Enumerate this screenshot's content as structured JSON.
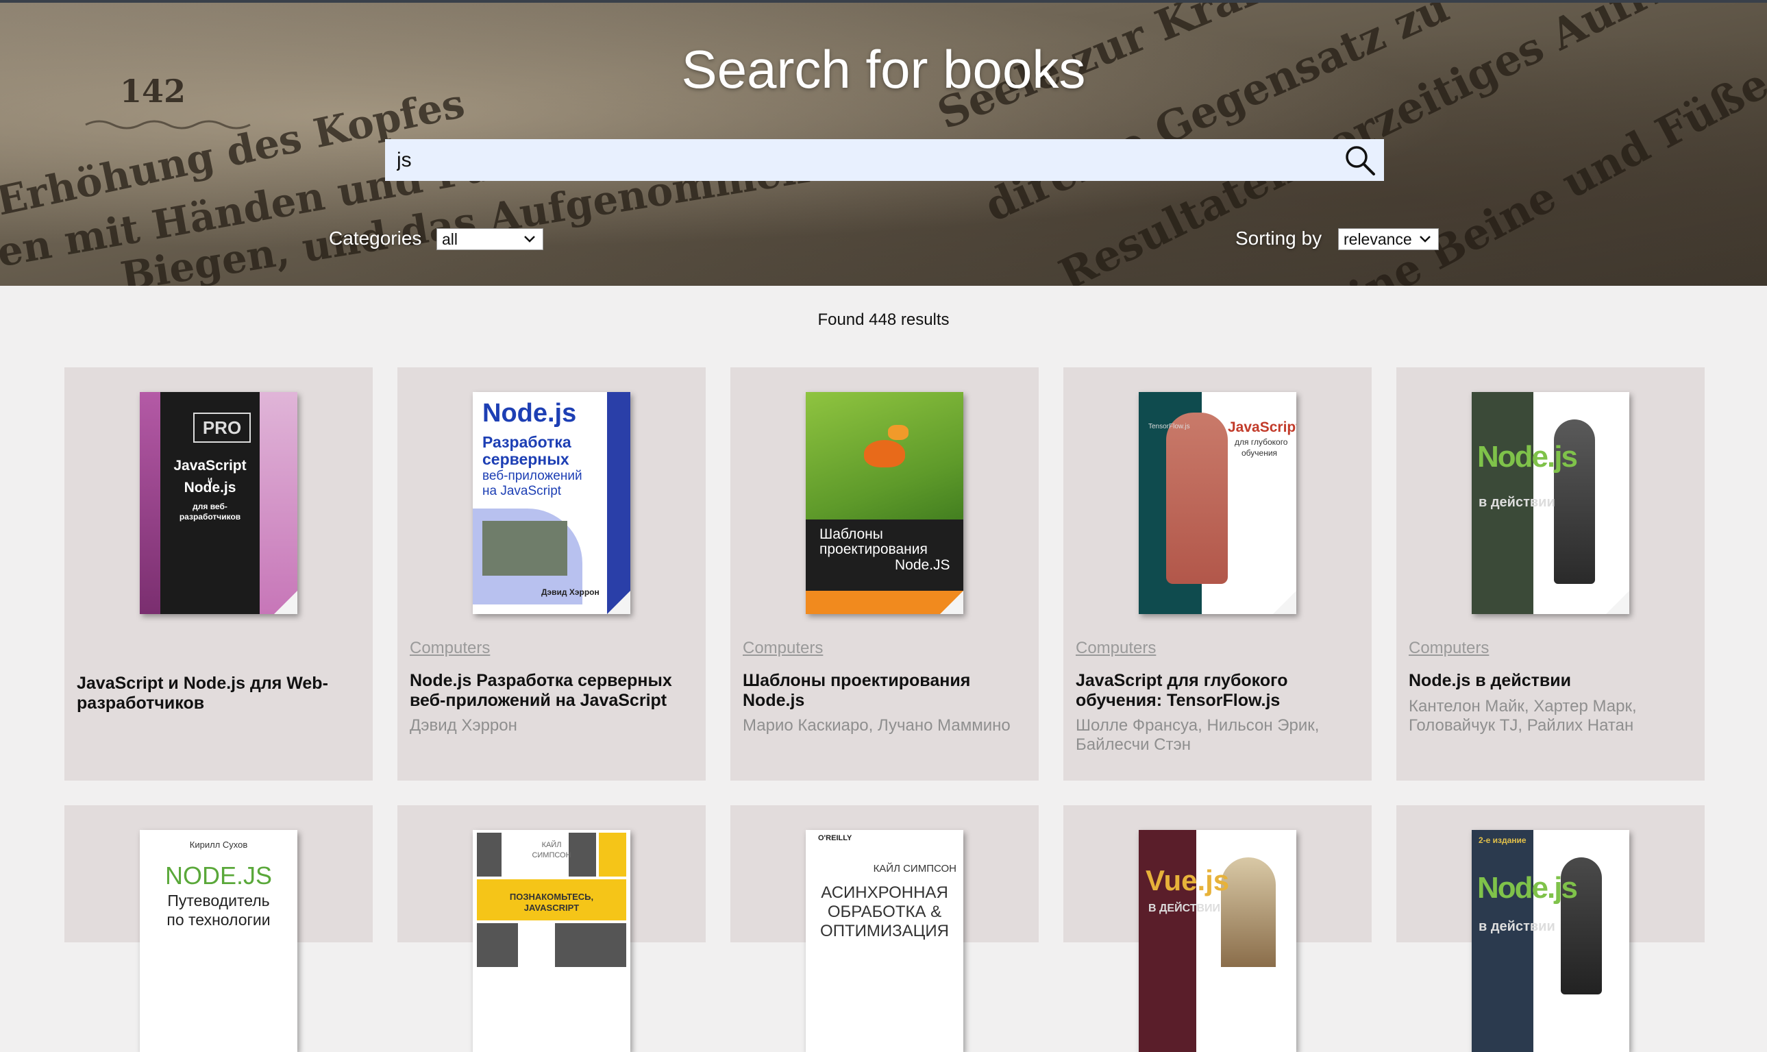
{
  "header": {
    "title": "Search for books",
    "search_value": "js",
    "categories_label": "Categories",
    "categories_value": "all",
    "sorting_label": "Sorting by",
    "sorting_value": "relevance"
  },
  "results": {
    "text": "Found 448 results"
  },
  "books": [
    {
      "category": "",
      "title": "JavaScript и Node.js для Web-разработчиков",
      "authors": "",
      "cover": {
        "line1": "PRO",
        "line2": "JavaScript",
        "line3": "и",
        "line4": "Node.js",
        "line5": "для веб-",
        "line6": "разработчиков"
      }
    },
    {
      "category": "Computers",
      "title": "Node.js Разработка серверных веб-приложений на JavaScript",
      "authors": "Дэвид Хэррон",
      "cover": {
        "line1": "Node.js",
        "line2": "Разработка",
        "line3": "серверных",
        "line4": "веб-приложений",
        "line5": "на JavaScript",
        "line6": "Дэвид Хэррон"
      }
    },
    {
      "category": "Computers",
      "title": "Шаблоны проектирования Node.js",
      "authors": "Марио Каскиаро, Лучано Маммино",
      "cover": {
        "line1": "Шаблоны",
        "line2": "проектирования",
        "line3": "Node.JS"
      }
    },
    {
      "category": "Computers",
      "title": "JavaScript для глубокого обучения: TensorFlow.js",
      "authors": "Шолле Франсуа, Нильсон Эрик, Байлесчи Стэн",
      "cover": {
        "line1": "JavaScript",
        "line2": "для глубокого",
        "line3": "обучения",
        "line4": "TensorFlow.js"
      }
    },
    {
      "category": "Computers",
      "title": "Node.js в действии",
      "authors": "Кантелон Майк, Хартер Марк, Головайчук TJ, Райлих Натан",
      "cover": {
        "line1": "Node.js",
        "line2": "в действии"
      }
    },
    {
      "category": "",
      "title": "",
      "authors": "",
      "cover": {
        "line1": "Кирилл Сухов",
        "line2": "NODE.JS",
        "line3": "Путеводитель",
        "line4": "по технологии"
      }
    },
    {
      "category": "",
      "title": "",
      "authors": "",
      "cover": {
        "line1": "КАЙЛ",
        "line2": "СИМПСОН",
        "line3": "ПОЗНАКОМЬТЕСЬ,",
        "line4": "JAVASCRIPT"
      }
    },
    {
      "category": "",
      "title": "",
      "authors": "",
      "cover": {
        "line1": "O'REILLY",
        "line2": "КАЙЛ СИМПСОН",
        "line3": "АСИНХРОННАЯ",
        "line4": "ОБРАБОТКА &",
        "line5": "ОПТИМИЗАЦИЯ"
      }
    },
    {
      "category": "",
      "title": "",
      "authors": "",
      "cover": {
        "line1": "Vue.js",
        "line2": "В ДЕЙСТВИИ"
      }
    },
    {
      "category": "",
      "title": "",
      "authors": "",
      "cover": {
        "line1": "2-е издание",
        "line2": "Node.js",
        "line3": "в действии"
      }
    }
  ],
  "icons": {
    "search": "search-icon",
    "chevron": "chevron-down-icon"
  },
  "colors": {
    "search_bg": "#e8f0fe",
    "card_bg": "#e2dcdc",
    "page_bg": "#f1f0f0",
    "category_text": "#9a9a9a"
  }
}
